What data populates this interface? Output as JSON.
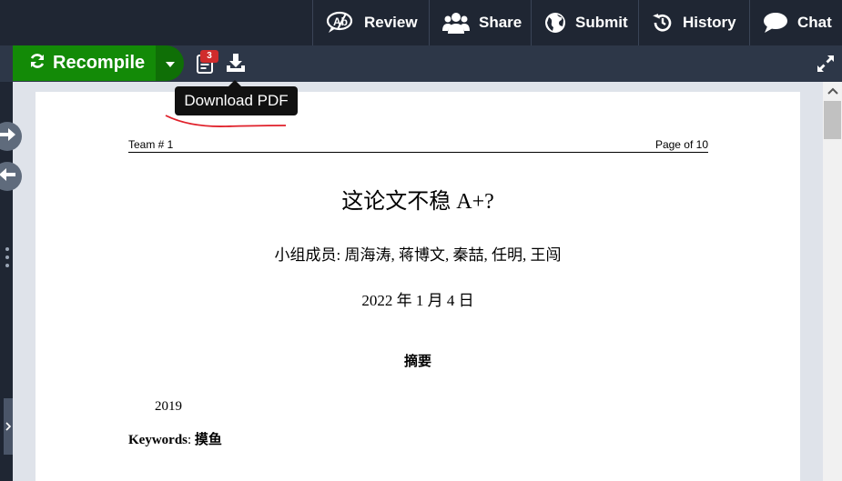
{
  "toolbar": {
    "buttons": [
      {
        "label": "Review",
        "icon": "review-icon"
      },
      {
        "label": "Share",
        "icon": "share-users-icon"
      },
      {
        "label": "Submit",
        "icon": "globe-icon"
      },
      {
        "label": "History",
        "icon": "history-icon"
      },
      {
        "label": "Chat",
        "icon": "chat-bubble-icon"
      }
    ]
  },
  "pdf_toolbar": {
    "recompile_label": "Recompile",
    "logs_badge": "3",
    "tooltip": "Download PDF"
  },
  "document": {
    "header_left": "Team # 1",
    "header_right": "Page  of 10",
    "title": "这论文不稳 A+?",
    "authors": "小组成员: 周海涛, 蒋博文, 秦喆, 任明, 王闯",
    "date": "2022 年 1 月 4 日",
    "abstract_heading": "摘要",
    "abstract_body": "2019",
    "keywords_label": "Keywords",
    "keywords_value": "摸鱼"
  },
  "colors": {
    "recompile_green": "#138a07",
    "toolbar_dark": "#1f2633",
    "badge_red": "#d02c2c",
    "annotation_red": "#e0202a"
  }
}
